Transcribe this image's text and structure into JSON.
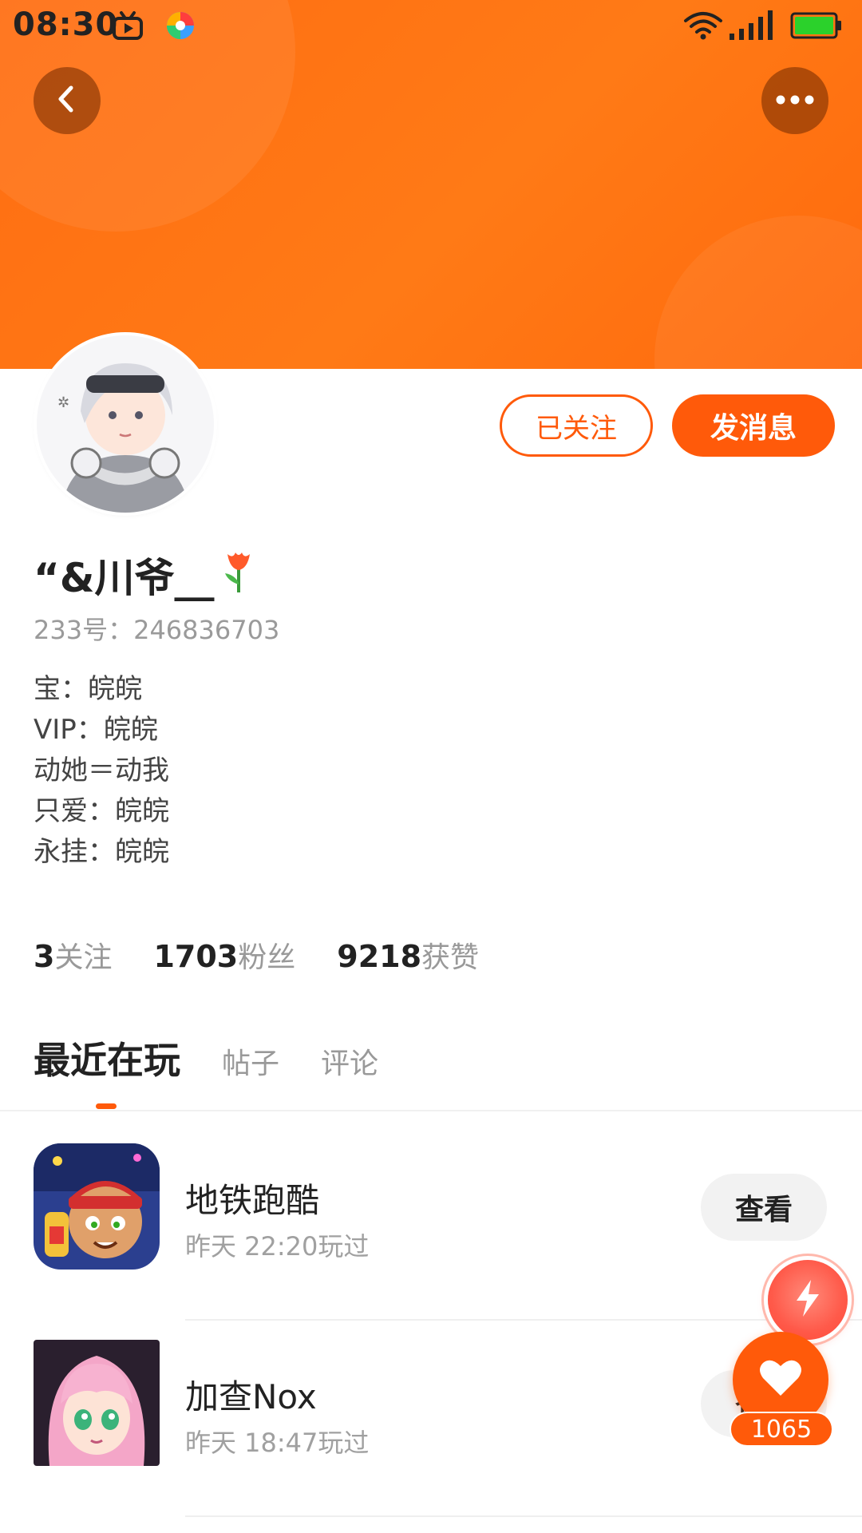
{
  "status_bar": {
    "time": "08:30",
    "icons": [
      "tv-icon",
      "colorful-ball-icon",
      "wifi-icon",
      "signal-icon",
      "battery-icon"
    ]
  },
  "header": {
    "back_icon": "chevron-left-icon",
    "more_icon": "more-horizontal-icon",
    "accent_color": "#ff5a0a"
  },
  "profile": {
    "username": "“&川爷__",
    "id_text": "233号：246836703",
    "bio_lines": [
      "宝：皖皖",
      "VIP：皖皖",
      "动她＝动我",
      "只爱：皖皖",
      "永挂：皖皖"
    ],
    "followed_label": "已关注",
    "message_label": "发消息"
  },
  "stats": [
    {
      "value": "3",
      "label": "关注"
    },
    {
      "value": "1703",
      "label": "粉丝"
    },
    {
      "value": "9218",
      "label": "获赞"
    }
  ],
  "tabs": [
    {
      "label": "最近在玩",
      "active": true
    },
    {
      "label": "帖子",
      "active": false
    },
    {
      "label": "评论",
      "active": false
    }
  ],
  "games": [
    {
      "name": "地铁跑酷",
      "time": "昨天 22:20玩过",
      "action": "查看"
    },
    {
      "name": "加查Nox",
      "time": "昨天 18:47玩过",
      "action": "查看"
    }
  ],
  "fab": {
    "like_count": "1065"
  }
}
